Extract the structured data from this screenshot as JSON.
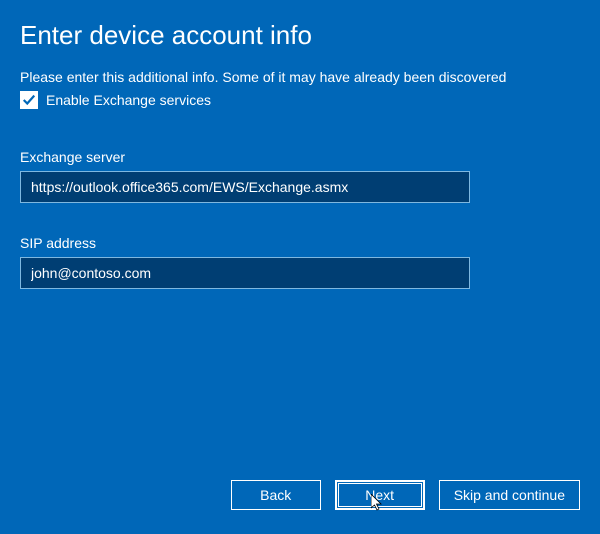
{
  "header": {
    "title": "Enter device account info"
  },
  "subtitle": "Please enter this additional info. Some of it may have already been discovered",
  "checkbox": {
    "label": "Enable Exchange services",
    "checked": true
  },
  "fields": {
    "exchange_server": {
      "label": "Exchange server",
      "value": "https://outlook.office365.com/EWS/Exchange.asmx"
    },
    "sip_address": {
      "label": "SIP address",
      "value": "john@contoso.com"
    }
  },
  "buttons": {
    "back": "Back",
    "next": "Next",
    "skip": "Skip and continue"
  },
  "colors": {
    "background": "#0067b8",
    "input_bg": "#003e73",
    "input_border": "#7fb8e0"
  }
}
